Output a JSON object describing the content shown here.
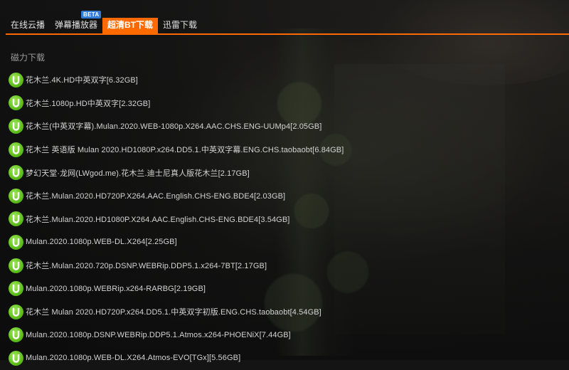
{
  "tabs": [
    {
      "label": "在线云播",
      "active": false
    },
    {
      "label": "弹幕播放器",
      "active": false,
      "badge": "BETA"
    },
    {
      "label": "超清BT下载",
      "active": true
    },
    {
      "label": "迅雷下载",
      "active": false
    }
  ],
  "section_title": "磁力下载",
  "icon": "utorrent-icon",
  "colors": {
    "accent": "#ff6a00",
    "badge": "#2f7bd6",
    "icon_green": "#6ccf24"
  },
  "downloads": [
    "花木兰.4K.HD中英双字[6.32GB]",
    "花木兰.1080p.HD中英双字[2.32GB]",
    "花木兰(中英双字幕).Mulan.2020.WEB-1080p.X264.AAC.CHS.ENG-UUMp4[2.05GB]",
    "花木兰 英语版 Mulan 2020.HD1080P.x264.DD5.1.中英双字幕.ENG.CHS.taobaobt[6.84GB]",
    "梦幻天堂·龙网(LWgod.me).花木兰.迪士尼真人版花木兰[2.17GB]",
    "花木兰.Mulan.2020.HD720P.X264.AAC.English.CHS-ENG.BDE4[2.03GB]",
    "花木兰.Mulan.2020.HD1080P.X264.AAC.English.CHS-ENG.BDE4[3.54GB]",
    "Mulan.2020.1080p.WEB-DL.X264[2.25GB]",
    "花木兰.Mulan.2020.720p.DSNP.WEBRip.DDP5.1.x264-7BT[2.17GB]",
    "Mulan.2020.1080p.WEBRip.x264-RARBG[2.19GB]",
    "花木兰 Mulan 2020.HD720P.x264.DD5.1.中英双字初版.ENG.CHS.taobaobt[4.54GB]",
    "Mulan.2020.1080p.DSNP.WEBRip.DDP5.1.Atmos.x264-PHOENiX[7.44GB]",
    "Mulan.2020.1080p.WEB-DL.X264.Atmos-EVO[TGx][5.56GB]"
  ]
}
